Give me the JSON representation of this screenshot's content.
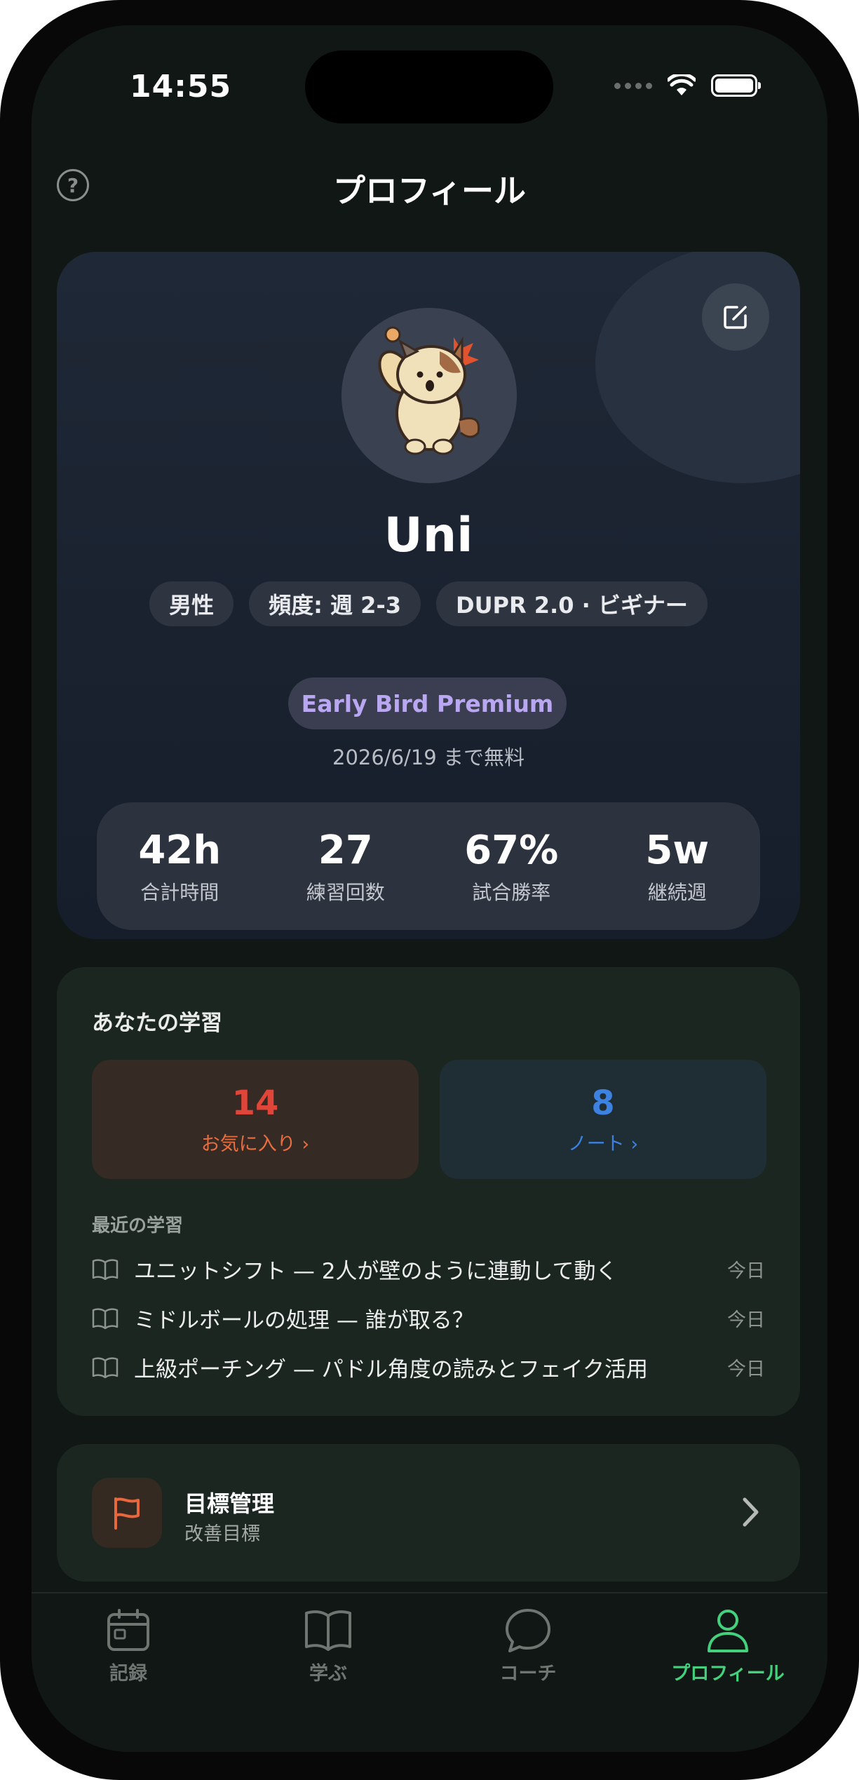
{
  "status_bar": {
    "time": "14:55"
  },
  "header": {
    "title": "プロフィール",
    "help_icon": "question-circle-icon"
  },
  "profile": {
    "name": "Uni",
    "chips": [
      "男性",
      "頻度: 週 2-3",
      "DUPR 2.0 · ビギナー"
    ],
    "plan": "Early Bird Premium",
    "plan_note": "2026/6/19 まで無料",
    "stats": [
      {
        "value": "42h",
        "label": "合計時間"
      },
      {
        "value": "27",
        "label": "練習回数"
      },
      {
        "value": "67%",
        "label": "試合勝率"
      },
      {
        "value": "5w",
        "label": "継続週"
      }
    ]
  },
  "learning": {
    "title": "あなたの学習",
    "favorites": {
      "count": "14",
      "label": "お気に入り ›"
    },
    "notes": {
      "count": "8",
      "label": "ノート ›"
    },
    "recent_title": "最近の学習",
    "recent": [
      {
        "text": "ユニットシフト — 2人が壁のように連動して動く",
        "time": "今日"
      },
      {
        "text": "ミドルボールの処理 — 誰が取る？",
        "time": "今日"
      },
      {
        "text": "上級ポーチング — パドル角度の読みとフェイク活用",
        "time": "今日"
      }
    ]
  },
  "goal": {
    "title": "目標管理",
    "subtitle": "改善目標"
  },
  "tabs": [
    {
      "label": "記録",
      "icon": "calendar-icon"
    },
    {
      "label": "学ぶ",
      "icon": "book-icon"
    },
    {
      "label": "コーチ",
      "icon": "chat-bubble-icon"
    },
    {
      "label": "プロフィール",
      "icon": "person-icon",
      "active": true
    }
  ],
  "colors": {
    "accent_green": "#43d17e",
    "favorite_red": "#e0453a",
    "favorite_orange": "#e86d3f",
    "note_blue": "#3d82e0",
    "premium_purple": "#b9a7f2"
  }
}
